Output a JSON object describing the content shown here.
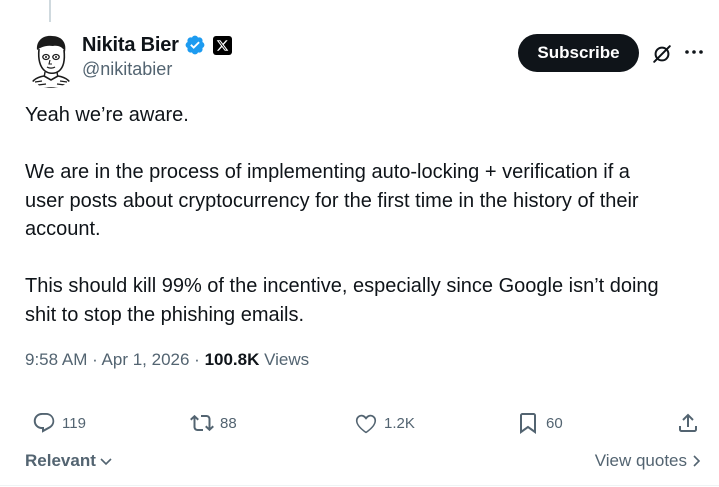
{
  "colors": {
    "text_primary": "#0f1419",
    "text_secondary": "#536471",
    "verified_blue": "#1d9bf0",
    "subscribe_bg": "#0f1419",
    "thread_line": "#cfd9de"
  },
  "author": {
    "name": "Nikita Bier",
    "handle": "@nikitabier",
    "verified_badge_icon": "verified-badge-icon",
    "affiliation_icon": "x-logo-icon",
    "avatar": "avatar-illustration"
  },
  "header": {
    "subscribe_label": "Subscribe",
    "grok_icon": "grok-icon",
    "more_icon": "more-options-icon"
  },
  "tweet": {
    "paragraphs": [
      "Yeah we’re aware.",
      "We are in the process of implementing auto-locking + verification if a user posts about cryptocurrency for the first time in the history of their account.",
      "This should kill 99% of the incentive, especially since Google isn’t doing shit to stop the phishing emails."
    ],
    "lines": [
      "Yeah we’re aware.",
      "",
      "We are in the process of implementing auto-locking + verification if a",
      "user posts about cryptocurrency for the first time in the history of their",
      "account.",
      "",
      "This should kill 99% of the incentive, especially since Google isn’t doing",
      "shit to stop the phishing emails."
    ]
  },
  "meta": {
    "time": "9:58 AM",
    "separator": " · ",
    "date": "Apr 1, 2026",
    "views_count": "100.8K",
    "views_label": " Views"
  },
  "actions": {
    "replies": "119",
    "reposts": "88",
    "likes": "1.2K",
    "bookmarks": "60"
  },
  "footer": {
    "sort_label": "Relevant",
    "view_quotes_label": "View quotes"
  }
}
